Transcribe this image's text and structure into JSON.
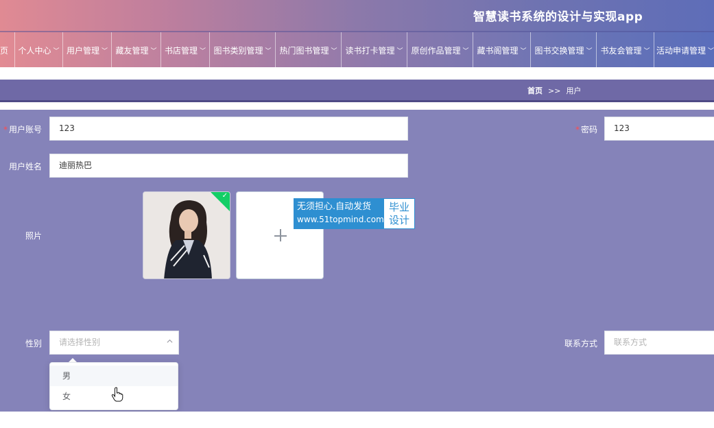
{
  "header": {
    "title": "智慧读书系统的设计与实现app"
  },
  "nav": {
    "items": [
      {
        "label": "页",
        "has_chevron": false
      },
      {
        "label": "个人中心",
        "has_chevron": true
      },
      {
        "label": "用户管理",
        "has_chevron": true
      },
      {
        "label": "藏友管理",
        "has_chevron": true
      },
      {
        "label": "书店管理",
        "has_chevron": true
      },
      {
        "label": "图书类别管理",
        "has_chevron": true
      },
      {
        "label": "热门图书管理",
        "has_chevron": true
      },
      {
        "label": "读书打卡管理",
        "has_chevron": true
      },
      {
        "label": "原创作品管理",
        "has_chevron": true
      },
      {
        "label": "藏书阁管理",
        "has_chevron": true
      },
      {
        "label": "图书交换管理",
        "has_chevron": true
      },
      {
        "label": "书友会管理",
        "has_chevron": true
      },
      {
        "label": "活动申请管理",
        "has_chevron": true
      }
    ]
  },
  "breadcrumb": {
    "home": "首页",
    "separator": ">>",
    "current": "用户"
  },
  "form": {
    "account": {
      "label": "用户账号",
      "value": "123",
      "required": true
    },
    "password": {
      "label": "密码",
      "value": "123",
      "required": true
    },
    "name": {
      "label": "用户姓名",
      "value": "迪丽热巴"
    },
    "photo": {
      "label": "照片"
    },
    "gender": {
      "label": "性别",
      "placeholder": "请选择性别",
      "options": [
        "男",
        "女"
      ]
    },
    "contact": {
      "label": "联系方式",
      "placeholder": "联系方式"
    }
  },
  "watermark": {
    "line1": "无须担心.自动发货",
    "line2": "www.51topmind.com",
    "right_line1": "毕业",
    "right_line2": "设计"
  },
  "colors": {
    "accent_form_bg": "#8583b9",
    "crumb_bar": "#6f69a6",
    "required": "#ff4d4f",
    "success_check": "#13ce66",
    "watermark_blue": "#2e8fd1"
  }
}
